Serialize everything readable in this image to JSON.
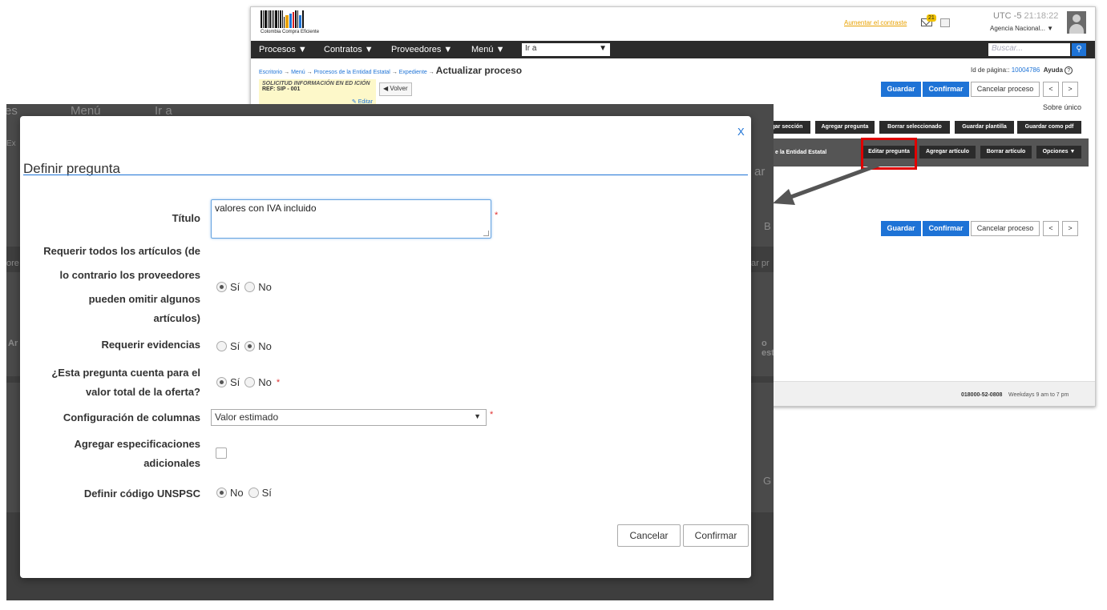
{
  "background": {
    "logo_caption": "Colombia Compra Eficiente",
    "contrast_link": "Aumentar el contraste",
    "mail_badge": "21",
    "utc": "UTC -5",
    "clock": "21:18:22",
    "agency": "Agencia Nacional...",
    "nav": [
      "Procesos",
      "Contratos",
      "Proveedores",
      "Menú"
    ],
    "goto_value": "Ir a",
    "search_placeholder": "Buscar...",
    "breadcrumb": [
      "Escritorio",
      "Menú",
      "Procesos de la Entidad Estatal",
      "Expediente"
    ],
    "breadcrumb_current": "Actualizar proceso",
    "page_id_label": "Id de página::",
    "page_id": "10004786",
    "help": "Ayuda",
    "ref_title": "SOLICITUD INFORMACIÓN EN ED ICIÓN",
    "ref_code": "REF: SIP - 001",
    "edit_link": "Editar",
    "back": "Volver",
    "save": "Guardar",
    "confirm": "Confirmar",
    "cancel_process": "Cancelar proceso",
    "prev": "<",
    "next": ">",
    "sobre": "Sobre único",
    "toolbar_buttons": [
      "gar sección",
      "Agregar pregunta",
      "Borrar seleccionado",
      "Guardar plantilla",
      "Guardar como pdf"
    ],
    "toolbar2_label": "e la Entidad Estatal",
    "toolbar2_buttons": [
      "Editar pregunta",
      "Agregar artículo",
      "Borrar artículo",
      "Opciones"
    ],
    "phone": "018000-52-0808",
    "hours": "Weekdays 9 am to 7 pm"
  },
  "overlay": {
    "nav_fragments": [
      "es",
      "Menú",
      "Ir a"
    ],
    "side_fragments": [
      "Ex",
      "ar",
      "B",
      "ore",
      "ar pr",
      "Ar",
      "o est",
      "G"
    ]
  },
  "modal": {
    "close": "X",
    "title": "Definir pregunta",
    "fields": {
      "titulo_label": "Título",
      "titulo_value": "valores con IVA incluido",
      "require_all_label": [
        "Requerir todos los artículos (de",
        "lo contrario los proveedores",
        "pueden omitir algunos",
        "artículos)"
      ],
      "require_evidence_label": "Requerir evidencias",
      "counts_label": [
        "¿Esta pregunta cuenta para el",
        "valor total de la oferta?"
      ],
      "columns_label": "Configuración de columnas",
      "columns_value": "Valor estimado",
      "extra_specs_label": [
        "Agregar especificaciones",
        "adicionales"
      ],
      "unspsc_label": "Definir código UNSPSC"
    },
    "options": {
      "yes": "Sí",
      "no": "No"
    },
    "required_mark": "*",
    "cancel": "Cancelar",
    "confirm": "Confirmar"
  },
  "colors": {
    "accent": "#1e73d6",
    "highlight": "#e00000",
    "overlay": "#4a4a4a"
  }
}
